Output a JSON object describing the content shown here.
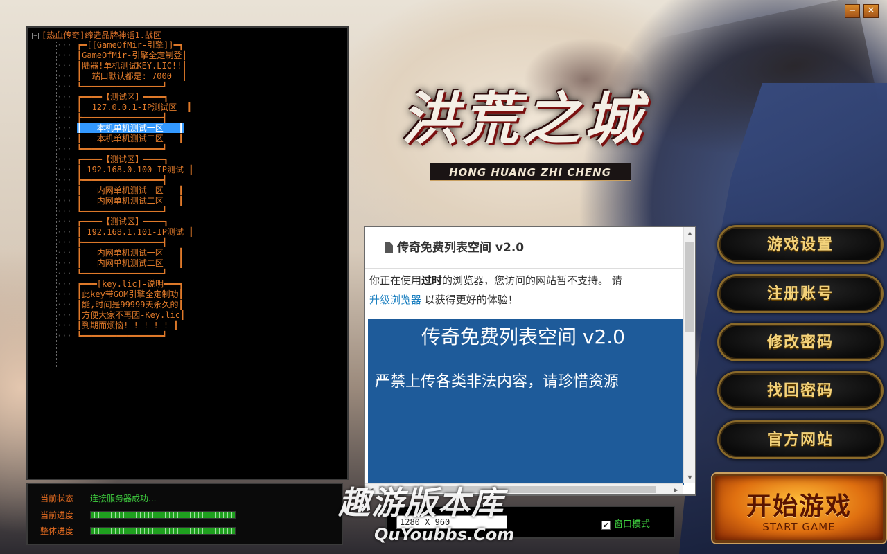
{
  "window": {
    "minimize_label": "−",
    "close_label": "✕"
  },
  "logo": {
    "title": "洪荒之城",
    "subtitle": "HONG HUANG ZHI CHENG"
  },
  "server_tree": {
    "root": "[热血传奇]缔造品牌神话1.战区",
    "items": [
      "┏━[[GameOfMir-引擎]]━┓",
      "┃GameOfMir-引擎全定制登┃",
      "┃陆器!单机测试KEY.LIC!!┃",
      "┃  端口默认都是: 7000  ┃",
      "┗━━━━━━━━━━━━━━━━┛",
      "┏━━━━【测试区】━━━━┓",
      "┃  127.0.0.1-IP测试区  ┃",
      "┣━━━━━━━━━━━━━━━━┫",
      "┃   本机单机测试一区   ┃",
      "┃   本机单机测试二区   ┃",
      "┗━━━━━━━━━━━━━━━━┛",
      "┏━━━━【测试区】━━━━┓",
      "┃ 192.168.0.100-IP测试 ┃",
      "┣━━━━━━━━━━━━━━━━┫",
      "┃   内网单机测试一区   ┃",
      "┃   内网单机测试二区   ┃",
      "┗━━━━━━━━━━━━━━━━┛",
      "┏━━━━【测试区】━━━━┓",
      "┃ 192.168.1.101-IP测试 ┃",
      "┣━━━━━━━━━━━━━━━━┫",
      "┃   内网单机测试一区   ┃",
      "┃   内网单机测试二区   ┃",
      "┗━━━━━━━━━━━━━━━━┛",
      "┏━━━[key.lic]-说明━━━┓",
      "┃此key带GOM引擎全定制功┃",
      "┃能,时间是99999天永久的┃",
      "┃方便大家不再因-Key.lic┃",
      "┃到期而烦恼! ! ! ! ! ┃",
      "┗━━━━━━━━━━━━━━━━┛"
    ],
    "selected_index": 8
  },
  "status": {
    "state_label": "当前状态",
    "state_value": "连接服务器成功...",
    "current_progress_label": "当前进度",
    "overall_progress_label": "整体进度",
    "current_progress": 1.0,
    "overall_progress": 1.0
  },
  "browser": {
    "page_title": "传奇免费列表空间 v2.0",
    "warning_prefix": "你正在使用",
    "warning_bold": "过时",
    "warning_mid": "的浏览器，您访问的网站暂不支持。 请",
    "warning_link": "升级浏览器",
    "warning_suffix": " 以获得更好的体验！",
    "banner_title": "传奇免费列表空间 v2.0",
    "banner_sub": "严禁上传各类非法内容，请珍惜资源"
  },
  "menu": {
    "game_settings": "游戏设置",
    "register": "注册账号",
    "change_password": "修改密码",
    "recover_password": "找回密码",
    "official_site": "官方网站"
  },
  "start": {
    "label_cn": "开始游戏",
    "label_en": "START GAME"
  },
  "display": {
    "resolution": "1280 X 960",
    "window_mode_label": "窗口模式",
    "window_mode_checked": true
  },
  "watermark": {
    "cn": "趣游版本库",
    "en": "QuYoubbs.Com"
  },
  "colors": {
    "tree_text": "#e07a2a",
    "status_value": "#3fcf3f",
    "menu_text": "#f3d27a",
    "browser_banner": "#1e5b9a"
  }
}
